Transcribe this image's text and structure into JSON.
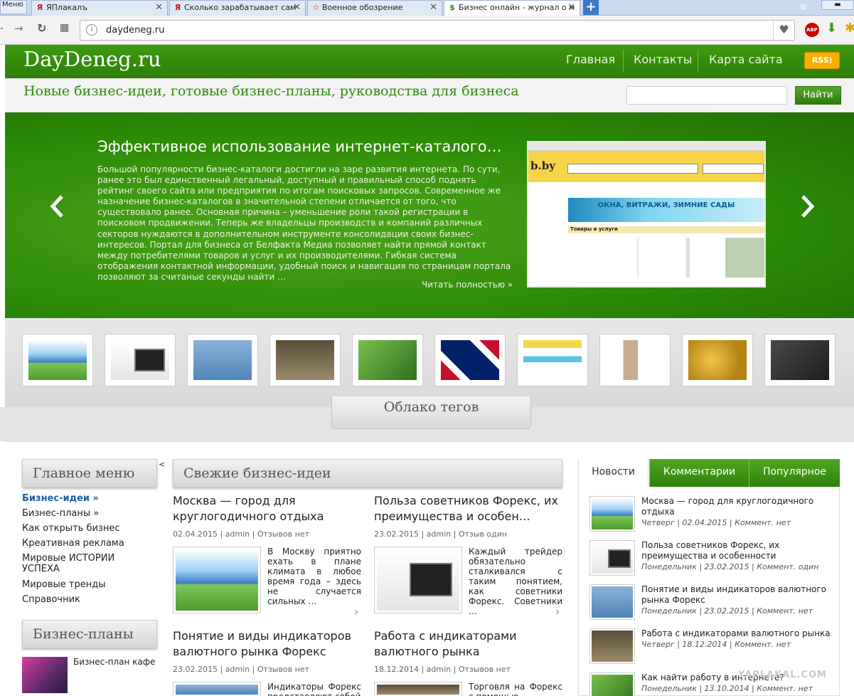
{
  "browser": {
    "menu_label": "Меню",
    "tabs": [
      {
        "title": "ЯПлакалъ",
        "active": false
      },
      {
        "title": "Сколько зарабатывает сам",
        "active": false
      },
      {
        "title": "Военное обозрение",
        "active": false
      },
      {
        "title": "Бизнес онлайн - журнал о м",
        "active": true
      }
    ],
    "new_tab": "+",
    "url": "daydeneg.ru"
  },
  "site": {
    "logo": "DayDeneg.ru",
    "nav": [
      "Главная",
      "Контакты",
      "Карта сайта"
    ],
    "rss": "RSS",
    "tagline": "Новые бизнес-идеи, готовые бизнес-планы, руководства для бизнеса",
    "search_placeholder": "",
    "search_button": "Найти"
  },
  "slider": {
    "title": "Эффективное использование интернет-каталого…",
    "text": "Большой популярности бизнес-каталоги достигли на заре развития интернета. По сути, ранее это был единственный легальный, доступный и правильный способ поднять рейтинг своего сайта или предприятия по итогам поисковых запросов. Современное же назначение бизнес-каталогов в значительной степени отличается от того, что существовало ранее. Основная причина – уменьшение роли такой регистрации в поисковом продвижении. Теперь же владельцы производств и компаний различных секторов нуждаются в дополнительном инструменте консолидации своих бизнес-интересов. Портал для бизнеса от Белфакта Медиа позволяет найти прямой контакт между потребителями товаров и услуг и их производителями. Гибкая система отображения контактной информации, удобный поиск и навигация по страницам портала позволяют за считаные секунды найти …",
    "read_more": "Читать полностью »",
    "prev": "‹",
    "next": "›",
    "banner_text": "ОКНА, ВИТРАЖИ, ЗИМНИЕ САДЫ",
    "banner_section": "Товары и услуги"
  },
  "tag_cloud": "Облако тегов",
  "left_menu": {
    "title": "Главное меню",
    "items": [
      "Бизнес-идеи »",
      "Бизнес-планы »",
      "Как открыть бизнес",
      "Креативная реклама",
      "Мировые ИСТОРИИ УСПЕХА",
      "Мировые тренды",
      "Справочник"
    ],
    "plans_title": "Бизнес-планы",
    "plan_item": "Бизнес-план кафе"
  },
  "news": {
    "title": "Свежие бизнес-идеи",
    "posts": [
      {
        "title": "Москва — город для круглогодичного отдыха",
        "meta": "02.04.2015 | admin | Отзывов нет",
        "text": "В Москву приятно ехать в плане климата в любое время года – здесь не случается сильных …"
      },
      {
        "title": "Польза советников Форекс, их преимущества и особен…",
        "meta": "23.02.2015 | admin | Отзыв один",
        "text": "Каждый трейдер обязательно сталкивался с таким понятием, как советники Форекс. Советники …"
      },
      {
        "title": "Понятие и виды индикаторов валютного рынка Форекс",
        "meta": "23.02.2015 | admin | Отзывов нет",
        "text": "Индикаторы Форекс представляют собой"
      },
      {
        "title": "Работа с индикаторами валютного рынка",
        "meta": "18.12.2014 | admin | Отзывов нет",
        "text": "Торговля на Форекс с помощью"
      }
    ]
  },
  "side_tabs": {
    "tabs": [
      "Новости",
      "Комментарии",
      "Популярное"
    ],
    "items": [
      {
        "title": "Москва — город для круглогодичного отдыха",
        "meta": "Четверг | 02.04.2015 | Коммент. нет"
      },
      {
        "title": "Польза советников Форекс, их преимущества и особенности",
        "meta": "Понедельник | 23.02.2015 | Коммент. один"
      },
      {
        "title": "Понятие и виды индикаторов валютного рынка Форекс",
        "meta": "Понедельник | 23.02.2015 | Коммент. нет"
      },
      {
        "title": "Работа с индикаторами валютного рынка",
        "meta": "Четверг | 18.12.2014 | Коммент. нет"
      },
      {
        "title": "Как найти работу в интернете?",
        "meta": "Понедельник | 13.10.2014 | Коммент. нет"
      }
    ]
  },
  "watermark": "YAPLAKAL.COM"
}
